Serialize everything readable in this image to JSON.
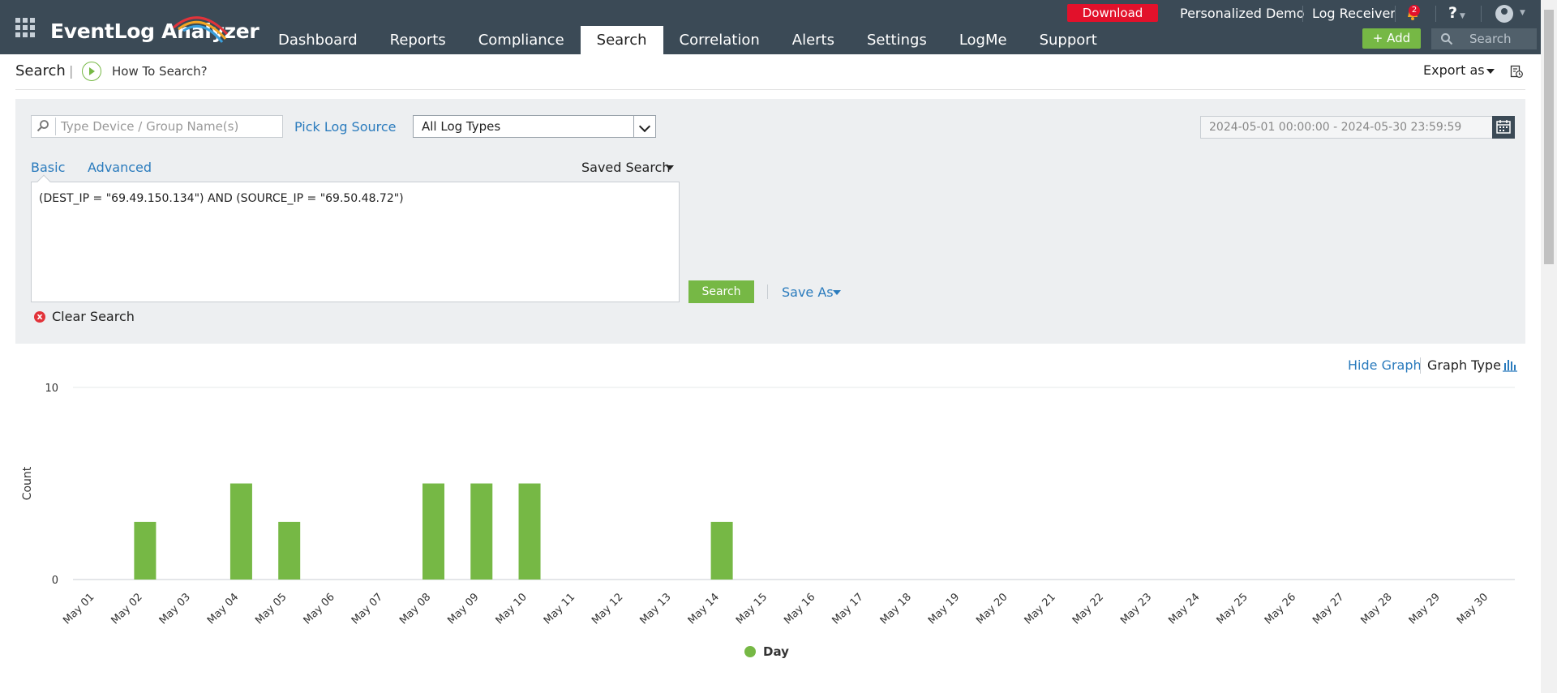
{
  "app": {
    "logo_text": "EventLog Analyzer"
  },
  "nav": {
    "items": [
      "Dashboard",
      "Reports",
      "Compliance",
      "Search",
      "Correlation",
      "Alerts",
      "Settings",
      "LogMe",
      "Support"
    ],
    "active": "Search"
  },
  "top_right": {
    "download_label": "Download",
    "personalized_demo": "Personalized Demo",
    "log_receiver": "Log Receiver",
    "notification_count": "2",
    "help_label": "?",
    "add_label": "Add",
    "search_placeholder": "Search"
  },
  "subheader": {
    "title": "Search",
    "separator": "|",
    "how_to": "How To Search?",
    "export_label": "Export as"
  },
  "search_panel": {
    "device_placeholder": "Type Device / Group Name(s)",
    "pick_log_source": "Pick Log Source",
    "log_type_selected": "All Log Types",
    "date_range": "2024-05-01 00:00:00 - 2024-05-30 23:59:59",
    "tabs": {
      "basic": "Basic",
      "advanced": "Advanced"
    },
    "saved_search": "Saved Search",
    "query": "(DEST_IP = \"69.49.150.134\") AND (SOURCE_IP = \"69.50.48.72\")",
    "search_button": "Search",
    "save_as": "Save As",
    "clear_search": "Clear Search",
    "clear_icon": "x"
  },
  "graph_controls": {
    "hide_graph": "Hide Graph",
    "graph_type": "Graph Type"
  },
  "colors": {
    "topbar": "#3b4a56",
    "accent_green": "#76b845",
    "link_blue": "#2a7bbd",
    "download_red": "#e2112b"
  },
  "chart_data": {
    "type": "bar",
    "ylabel": "Count",
    "xlabel": "",
    "ylim": [
      0,
      10
    ],
    "yticks": [
      0,
      10
    ],
    "categories": [
      "May 01",
      "May 02",
      "May 03",
      "May 04",
      "May 05",
      "May 06",
      "May 07",
      "May 08",
      "May 09",
      "May 10",
      "May 11",
      "May 12",
      "May 13",
      "May 14",
      "May 15",
      "May 16",
      "May 17",
      "May 18",
      "May 19",
      "May 20",
      "May 21",
      "May 22",
      "May 23",
      "May 24",
      "May 25",
      "May 26",
      "May 27",
      "May 28",
      "May 29",
      "May 30"
    ],
    "series": [
      {
        "name": "Day",
        "color": "#76b845",
        "values": [
          0,
          3,
          0,
          5,
          3,
          0,
          0,
          5,
          5,
          5,
          0,
          0,
          0,
          3,
          0,
          0,
          0,
          0,
          0,
          0,
          0,
          0,
          0,
          0,
          0,
          0,
          0,
          0,
          0,
          0
        ]
      }
    ],
    "legend": "bottom-center",
    "grid": true
  }
}
